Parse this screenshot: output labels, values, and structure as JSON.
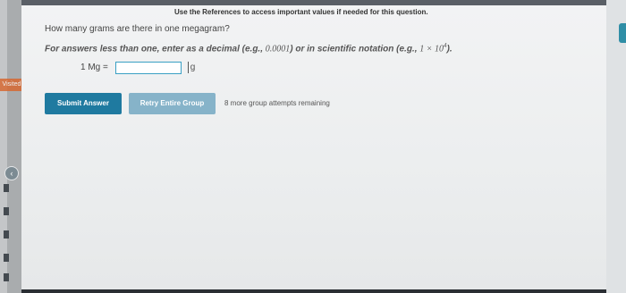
{
  "header": {
    "references_note": "Use the References to access important values if needed for this question."
  },
  "question": {
    "text": "How many grams are there in one megagram?",
    "instructions": {
      "prefix": "For answers less than one, enter as a decimal (e.g., ",
      "decimal_example": "0.0001",
      "middle": ") or in scientific notation (e.g., ",
      "sci_base": "1 × 10",
      "sci_exponent": "4",
      "suffix": ")."
    },
    "answer": {
      "label": "1 Mg =",
      "value": "",
      "unit": "g"
    }
  },
  "actions": {
    "submit_label": "Submit Answer",
    "retry_label": "Retry Entire Group",
    "attempts_text": "8 more group attempts remaining"
  },
  "sidebar": {
    "visited_badge": "Visited",
    "toggle_icon": "chevron-left-icon"
  },
  "colors": {
    "primary_button": "#1f7aa0",
    "secondary_button": "#86b3c9",
    "input_border": "#3aa0c4",
    "visited_badge": "#d9642a"
  }
}
